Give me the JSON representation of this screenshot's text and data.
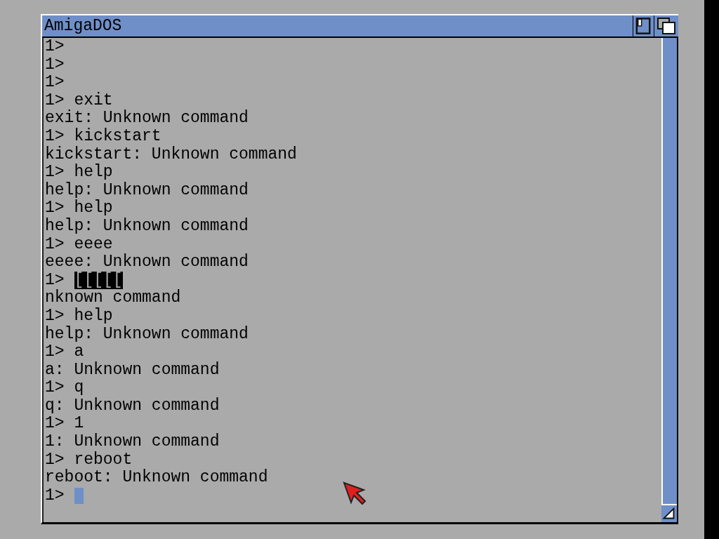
{
  "window": {
    "title": "AmigaDOS"
  },
  "lines": [
    {
      "kind": "prompt",
      "text": "1>"
    },
    {
      "kind": "prompt",
      "text": "1>"
    },
    {
      "kind": "prompt",
      "text": "1>"
    },
    {
      "kind": "prompt",
      "text": "1> exit"
    },
    {
      "kind": "output",
      "text": "exit: Unknown command"
    },
    {
      "kind": "prompt",
      "text": "1> kickstart"
    },
    {
      "kind": "output",
      "text": "kickstart: Unknown command"
    },
    {
      "kind": "prompt",
      "text": "1> help"
    },
    {
      "kind": "output",
      "text": "help: Unknown command"
    },
    {
      "kind": "prompt",
      "text": "1> help"
    },
    {
      "kind": "output",
      "text": "help: Unknown command"
    },
    {
      "kind": "prompt",
      "text": "1> eeee"
    },
    {
      "kind": "output",
      "text": "eeee: Unknown command"
    },
    {
      "kind": "selected_prompt",
      "prompt": "1>",
      "selection": "[[[[["
    },
    {
      "kind": "output",
      "text": "nknown command"
    },
    {
      "kind": "prompt",
      "text": "1> help"
    },
    {
      "kind": "output",
      "text": "help: Unknown command"
    },
    {
      "kind": "prompt",
      "text": "1> a"
    },
    {
      "kind": "output",
      "text": "a: Unknown command"
    },
    {
      "kind": "prompt",
      "text": "1> q"
    },
    {
      "kind": "output",
      "text": "q: Unknown command"
    },
    {
      "kind": "prompt",
      "text": "1> 1"
    },
    {
      "kind": "output",
      "text": "1: Unknown command"
    },
    {
      "kind": "prompt",
      "text": "1> reboot"
    },
    {
      "kind": "output",
      "text": "reboot: Unknown command"
    },
    {
      "kind": "cursor_prompt",
      "prompt": "1>"
    }
  ]
}
